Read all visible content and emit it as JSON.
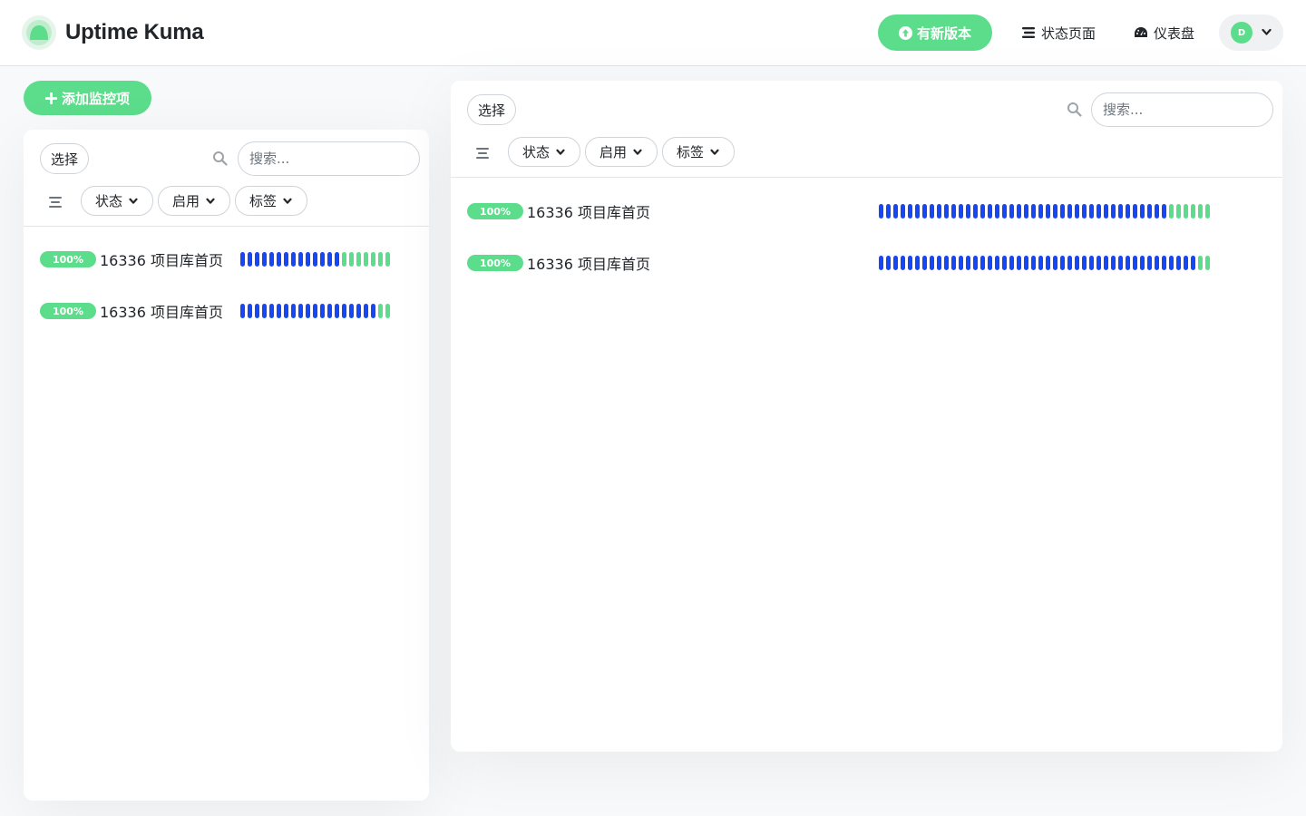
{
  "app": {
    "title": "Uptime Kuma"
  },
  "header": {
    "update_label": "有新版本",
    "status_pages_label": "状态页面",
    "dashboard_label": "仪表盘",
    "avatar_initial": "D"
  },
  "colors": {
    "accent": "#5cdd8b",
    "beat_blue": "#1747f5",
    "beat_green": "#5cdd8b"
  },
  "icons": {
    "logo": "uptime-kuma-logo",
    "update": "arrow-up-circle-icon",
    "status_pages": "list-icon",
    "dashboard": "tachometer-icon",
    "profile_dropdown": "chevron-down-icon",
    "add": "plus-icon",
    "search": "search-icon",
    "filter_menu": "filter-lines-icon"
  },
  "add_monitor_label": "+ 添加监控项",
  "add_monitor_text": "添加监控项",
  "left_panel": {
    "select_label": "选择",
    "search_placeholder": "搜索...",
    "filters": [
      {
        "label": "状态"
      },
      {
        "label": "启用"
      },
      {
        "label": "标签"
      }
    ],
    "monitors": [
      {
        "uptime": "100%",
        "name": "16336 项目库首页",
        "beats": {
          "blue": 14,
          "green": 7
        }
      },
      {
        "uptime": "100%",
        "name": "16336 项目库首页",
        "beats": {
          "blue": 19,
          "green": 2
        }
      }
    ]
  },
  "right_panel": {
    "select_label": "选择",
    "search_placeholder": "搜索...",
    "filters": [
      {
        "label": "状态"
      },
      {
        "label": "启用"
      },
      {
        "label": "标签"
      }
    ],
    "monitors": [
      {
        "uptime": "100%",
        "name": "16336 项目库首页",
        "beats": {
          "blue": 40,
          "green": 6
        }
      },
      {
        "uptime": "100%",
        "name": "16336 项目库首页",
        "beats": {
          "blue": 44,
          "green": 2
        }
      }
    ]
  }
}
